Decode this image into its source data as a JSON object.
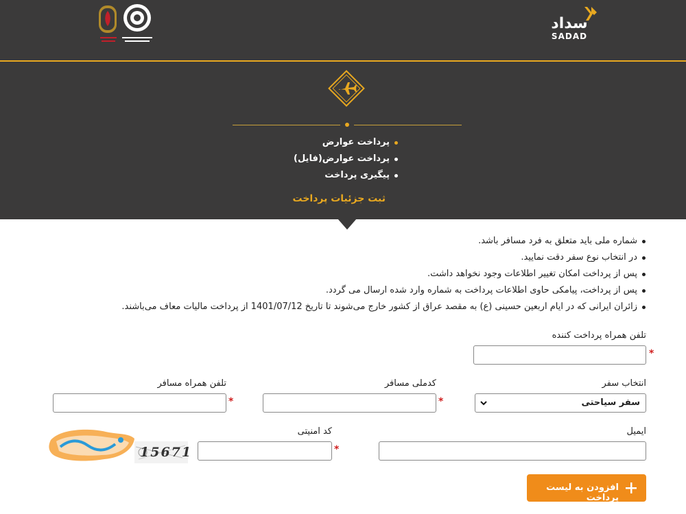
{
  "header": {
    "brand_fa": "سداد",
    "brand_en": "SADAD",
    "menu": [
      {
        "label": "پرداخت عوارض",
        "active": true
      },
      {
        "label": "پرداخت عوارض(فایل)",
        "active": false
      },
      {
        "label": "پیگیری پرداخت",
        "active": false
      }
    ],
    "section_title": "ثبت جزئیات پرداخت"
  },
  "notes": [
    "شماره ملی باید متعلق به فرد مسافر باشد.",
    "در انتخاب نوع سفر دقت نمایید.",
    "پس از پرداخت امکان تغییر اطلاعات وجود نخواهد داشت.",
    "پس از پرداخت، پیامکی حاوی اطلاعات پرداخت به شماره وارد شده ارسال می گردد.",
    "زائران ایرانی که در ایام اربعین حسینی (ع) به مقصد عراق از کشور خارج می‌شوند تا تاریخ 1401/07/12 از پرداخت مالیات معاف می‌باشند."
  ],
  "form": {
    "payer_phone_label": "تلفن همراه پرداخت کننده",
    "payer_phone_value": "",
    "trip_type_label": "انتخاب سفر",
    "trip_type_value": "سفر سیاحتی",
    "national_code_label": "کدملی مسافر",
    "national_code_value": "",
    "passenger_phone_label": "تلفن همراه مسافر",
    "passenger_phone_value": "",
    "email_label": "ایمیل",
    "email_value": "",
    "security_code_label": "کد امنیتی",
    "security_code_value": "",
    "required_mark": "*",
    "captcha_text": "15671",
    "add_button_label": "افزودن به لیست پرداخت"
  },
  "colors": {
    "header_bg": "#3b3a3a",
    "accent": "#e8a820",
    "button": "#f08c1a",
    "required": "#d02020"
  },
  "icons": {
    "brand": "sadad-logo-icon",
    "emblem": "airplane-icon",
    "select": "chevron-down-icon",
    "button": "plus-icon"
  }
}
